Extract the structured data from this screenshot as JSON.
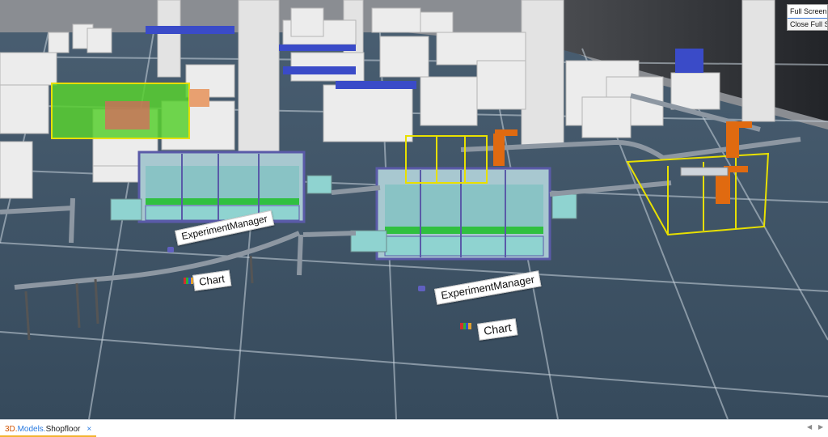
{
  "context_menu": {
    "items": [
      "Full Screen",
      "Close Full Screen"
    ]
  },
  "scene_labels": {
    "experiment_manager_1": "ExperimentManager",
    "chart_1": "Chart",
    "experiment_manager_2": "ExperimentManager",
    "chart_2": "Chart"
  },
  "tab": {
    "prefix": "3D.",
    "middle": "Models.",
    "suffix": "Shopfloor",
    "close": "×"
  },
  "nav": {
    "left": "◀",
    "right": "▶"
  },
  "colors": {
    "floor": "#3e5366",
    "grid": "#c9d3dc",
    "wall": "#2a2c30",
    "cabinet": "#ececec",
    "machine_frame": "#6f6fb8",
    "machine_panel": "#8fd3d0",
    "safety_fence": "#e8e000",
    "robot": "#e06a10",
    "conveyor": "#9aa3ad",
    "accent_tab": "#f3b431"
  },
  "icons": [
    "chart-bar-icon",
    "experiment-manager-icon",
    "close-icon",
    "scroll-left-icon",
    "scroll-right-icon"
  ]
}
